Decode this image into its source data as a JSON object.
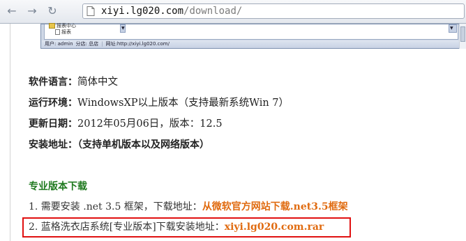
{
  "browser": {
    "url_host": "xiyi.lg020.com",
    "url_path": "/download/",
    "back_icon": "back-arrow-icon",
    "forward_icon": "forward-arrow-icon",
    "reload_icon": "reload-icon",
    "page_icon": "page-icon"
  },
  "embedded_screenshot": {
    "tree_items": [
      "报表中心",
      "报表"
    ],
    "status_user": "用户: admin",
    "status_branch": "分店: 总店",
    "status_site": "网址:http://xiyi.lg020.com/"
  },
  "info": {
    "language_label": "软件语言：",
    "language_value": "简体中文",
    "env_label": "运行环境：",
    "env_value": "WindowsXP以上版本（支持最新系统Win 7）",
    "date_label": "更新日期：",
    "date_value": "2012年05月06日，版本：12.5",
    "install_label": "安装地址：",
    "install_value": "（支持单机版本以及网络版本）"
  },
  "download": {
    "section_title": "专业版本下载",
    "item1_text": "1. 需要安装 .net 3.5 框架，下载地址：",
    "item1_link": "从微软官方网站下载.net3.5框架",
    "item2_text": "2. 蓝格洗衣店系统[专业版本]下载安装地址：",
    "item2_link": "xiyi.lg020.com.rar"
  },
  "colors": {
    "section_title": "#1f7a1f",
    "link": "#e06b10",
    "highlight_box": "#e01010"
  }
}
